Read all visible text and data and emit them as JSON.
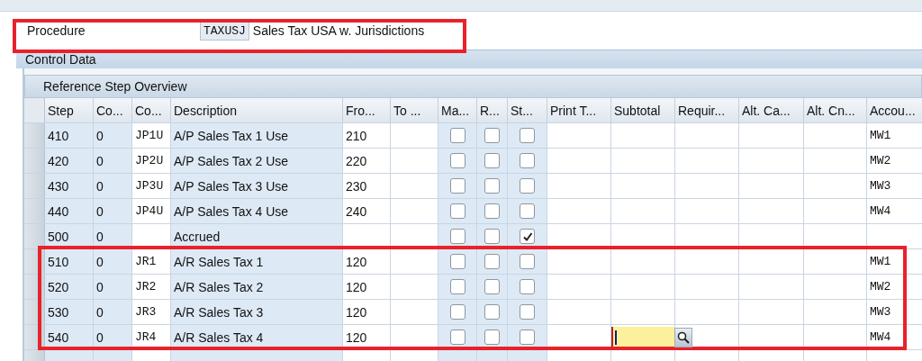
{
  "procedure": {
    "label": "Procedure",
    "code": "TAXUSJ",
    "description": "Sales Tax USA w. Jurisdictions"
  },
  "section_title": "Control Data",
  "table": {
    "title": "Reference Step Overview",
    "columns": [
      "Step",
      "Co...",
      "Co...",
      "Description",
      "Fro...",
      "To ...",
      "Ma...",
      "R...",
      "St...",
      "Print T...",
      "Subtotal",
      "Requir...",
      "Alt. Ca...",
      "Alt. Cn...",
      "Accou..."
    ],
    "rows": [
      {
        "step": "410",
        "counter": "0",
        "condition": "JP1U",
        "description": "A/P Sales Tax 1 Use",
        "from": "210",
        "manual": false,
        "required": false,
        "statistical": false,
        "subtotal_editing": false,
        "account": "MW1"
      },
      {
        "step": "420",
        "counter": "0",
        "condition": "JP2U",
        "description": "A/P Sales Tax 2 Use",
        "from": "220",
        "manual": false,
        "required": false,
        "statistical": false,
        "subtotal_editing": false,
        "account": "MW2"
      },
      {
        "step": "430",
        "counter": "0",
        "condition": "JP3U",
        "description": "A/P Sales Tax 3 Use",
        "from": "230",
        "manual": false,
        "required": false,
        "statistical": false,
        "subtotal_editing": false,
        "account": "MW3"
      },
      {
        "step": "440",
        "counter": "0",
        "condition": "JP4U",
        "description": "A/P Sales Tax 4 Use",
        "from": "240",
        "manual": false,
        "required": false,
        "statistical": false,
        "subtotal_editing": false,
        "account": "MW4"
      },
      {
        "step": "500",
        "counter": "0",
        "description": "Accrued",
        "manual": false,
        "required": false,
        "statistical": true,
        "subtotal_editing": false
      },
      {
        "step": "510",
        "counter": "0",
        "condition": "JR1",
        "description": "A/R Sales Tax 1",
        "from": "120",
        "manual": false,
        "required": false,
        "statistical": false,
        "subtotal_editing": false,
        "account": "MW1"
      },
      {
        "step": "520",
        "counter": "0",
        "condition": "JR2",
        "description": "A/R Sales Tax 2",
        "from": "120",
        "manual": false,
        "required": false,
        "statistical": false,
        "subtotal_editing": false,
        "account": "MW2"
      },
      {
        "step": "530",
        "counter": "0",
        "condition": "JR3",
        "description": "A/R Sales Tax 3",
        "from": "120",
        "manual": false,
        "required": false,
        "statistical": false,
        "subtotal_editing": false,
        "account": "MW3"
      },
      {
        "step": "540",
        "counter": "0",
        "condition": "JR4",
        "description": "A/R Sales Tax 4",
        "from": "120",
        "manual": false,
        "required": false,
        "statistical": false,
        "subtotal_editing": true,
        "account": "MW4"
      }
    ]
  }
}
